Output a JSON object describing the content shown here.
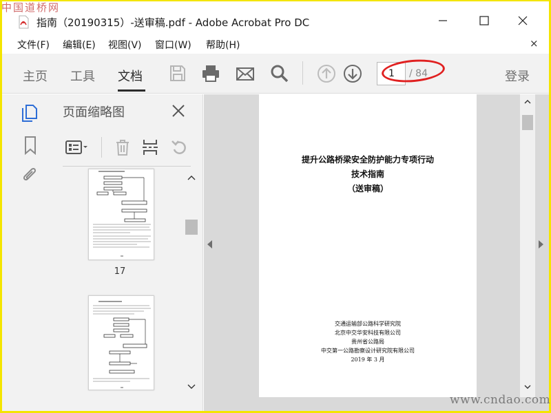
{
  "watermarks": {
    "top": "中国道桥网",
    "bottom": "www.cndao.com"
  },
  "window": {
    "title": "指南（20190315）-送审稿.pdf - Adobe Acrobat Pro DC"
  },
  "menu": {
    "items": [
      "文件(F)",
      "编辑(E)",
      "视图(V)",
      "窗口(W)",
      "帮助(H)"
    ],
    "close": "×"
  },
  "toolbar": {
    "tabs": [
      "主页",
      "工具",
      "文档"
    ],
    "active_tab": "文档",
    "page_current": "1",
    "page_total": "/ 84",
    "login": "登录",
    "icons": [
      "save-icon",
      "print-icon",
      "email-icon",
      "search-icon",
      "prev-page-icon",
      "next-page-icon"
    ]
  },
  "rail": {
    "icons": [
      "page-thumbnails-icon",
      "bookmark-icon",
      "attachment-icon"
    ]
  },
  "thumbnails": {
    "title": "页面缩略图",
    "page_label": "17",
    "tools": [
      "options-menu-icon",
      "delete-icon",
      "extract-icon",
      "rotate-icon"
    ]
  },
  "document": {
    "title_lines": [
      "提升公路桥梁安全防护能力专项行动",
      "技术指南",
      "（送审稿）"
    ],
    "orgs": [
      "交通运输部公路科学研究院",
      "北京中交华安科技有限公司",
      "贵州省公路局",
      "中交第一公路勘察设计研究院有限公司"
    ],
    "date": "2019 年 3 月"
  },
  "colors": {
    "accent_blue": "#2d6dd6",
    "annotation_red": "#e02020",
    "frame_yellow": "#f4e500"
  }
}
